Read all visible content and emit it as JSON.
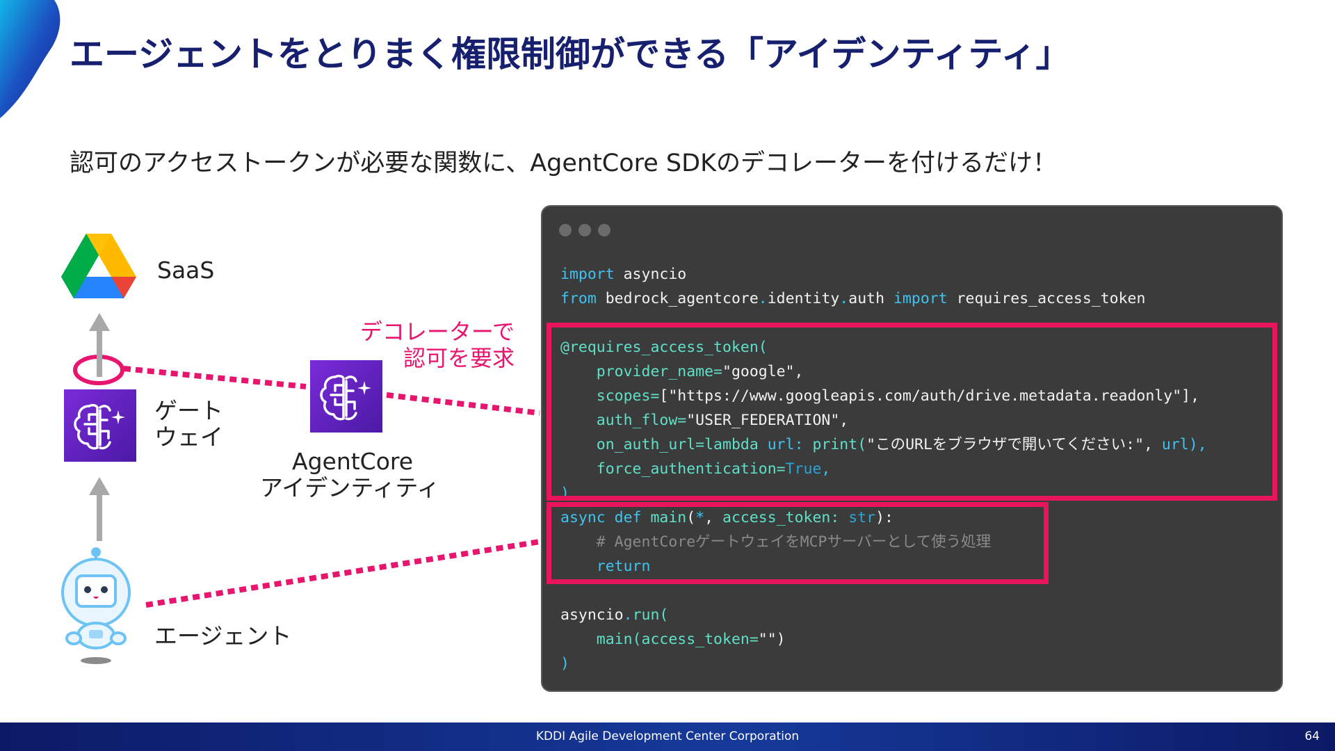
{
  "slide": {
    "title": "エージェントをとりまく権限制御ができる「アイデンティティ」",
    "subtitle": "認可のアクセストークンが必要な関数に、AgentCore SDKのデコレーターを付けるだけ！"
  },
  "diagram": {
    "saas_label": "SaaS",
    "gateway_label_line1": "ゲート",
    "gateway_label_line2": "ウェイ",
    "identity_label_line1": "AgentCore",
    "identity_label_line2": "アイデンティティ",
    "agent_label": "エージェント",
    "callout_line1": "デコレーターで",
    "callout_line2": "認可を要求",
    "colors": {
      "accent": "#e8156f",
      "tile": "#6a24c8",
      "arrow": "#a8a8a8"
    }
  },
  "code": {
    "language": "python",
    "lines": [
      "import asyncio",
      "from bedrock_agentcore.identity.auth import requires_access_token",
      "",
      "@requires_access_token(",
      "    provider_name=\"google\",",
      "    scopes=[\"https://www.googleapis.com/auth/drive.metadata.readonly\"],",
      "    auth_flow=\"USER_FEDERATION\",",
      "    on_auth_url=lambda url: print(\"このURLをブラウザで開いてください:\", url),",
      "    force_authentication=True,",
      ")",
      "async def main(*, access_token: str):",
      "    # AgentCoreゲートウェイをMCPサーバーとして使う処理",
      "    return",
      "",
      "asyncio.run(",
      "    main(access_token=\"\")",
      ")"
    ]
  },
  "footer": {
    "company": "KDDI Agile Development Center Corporation",
    "page_number": "64"
  }
}
